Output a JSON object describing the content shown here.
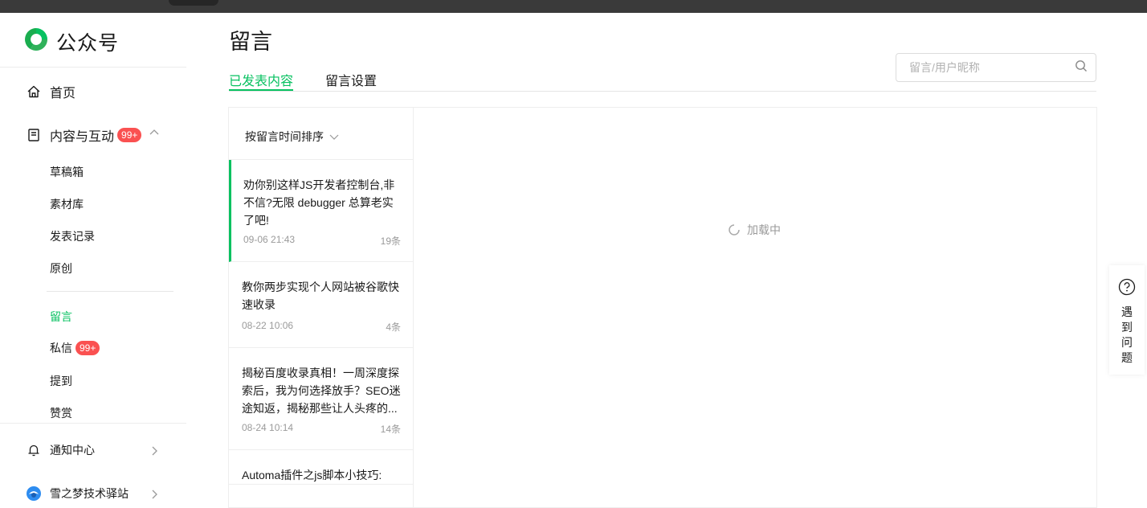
{
  "app": {
    "name": "公众号"
  },
  "sidebar": {
    "home": "首页",
    "content": {
      "label": "内容与互动",
      "badge": "99+"
    },
    "sub_items": [
      "草稿箱",
      "素材库",
      "发表记录",
      "原创"
    ],
    "comments": "留言",
    "messages": {
      "label": "私信",
      "badge": "99+"
    },
    "mentions": "提到",
    "rewards": "赞赏",
    "notify": "通知中心",
    "account": "雪之梦技术驿站"
  },
  "page": {
    "title": "留言",
    "tabs": [
      "已发表内容",
      "留言设置"
    ],
    "search_placeholder": "留言/用户昵称"
  },
  "list": {
    "sort_label": "按留言时间排序",
    "items": [
      {
        "title": "劝你别这样JS开发者控制台,非不信?无限 debugger 总算老实了吧!",
        "date": "09-06 21:43",
        "count": "19条"
      },
      {
        "title": "教你两步实现个人网站被谷歌快速收录",
        "date": "08-22 10:06",
        "count": "4条"
      },
      {
        "title": "揭秘百度收录真相！一周深度探索后，我为何选择放手？SEO迷途知返，揭秘那些让人头疼的...",
        "date": "08-24 10:14",
        "count": "14条"
      },
      {
        "title": "Automa插件之js脚本小技巧:",
        "date": "",
        "count": ""
      }
    ]
  },
  "detail": {
    "loading": "加载中"
  },
  "help": {
    "label": "遇到问题"
  },
  "colors": {
    "accent": "#07c160",
    "badge": "#fa5151"
  }
}
